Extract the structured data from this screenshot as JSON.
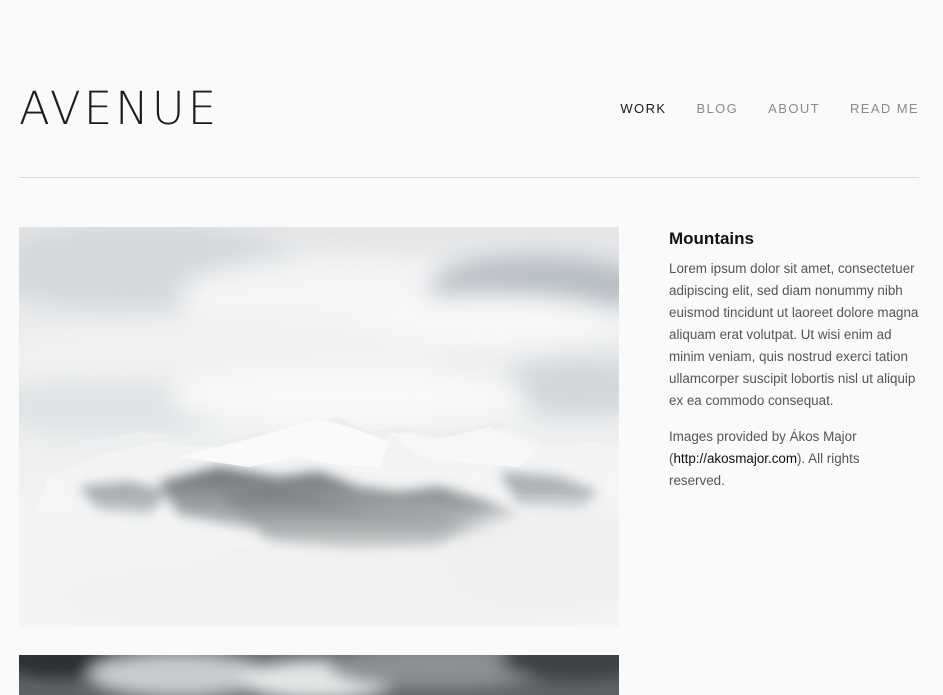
{
  "site": {
    "logo": "AVENUE"
  },
  "nav": [
    {
      "label": "WORK",
      "active": true
    },
    {
      "label": "BLOG",
      "active": false
    },
    {
      "label": "ABOUT",
      "active": false
    },
    {
      "label": "READ ME",
      "active": false
    }
  ],
  "project": {
    "title": "Mountains",
    "description": "Lorem ipsum dolor sit amet, consectetuer adipiscing elit, sed diam nonummy nibh euismod tincidunt ut laoreet dolore magna aliquam erat volutpat. Ut wisi enim ad minim veniam, quis nostrud exerci tation ullamcorper suscipit lobortis nisl ut aliquip ex ea commodo consequat.",
    "credit_prefix": "Images provided by Ákos Major (",
    "credit_link": "http://akosmajor.com",
    "credit_suffix": "). All rights reserved."
  },
  "colors": {
    "background": "#fafafa",
    "text": "#222222",
    "muted": "#8a8a8a"
  }
}
